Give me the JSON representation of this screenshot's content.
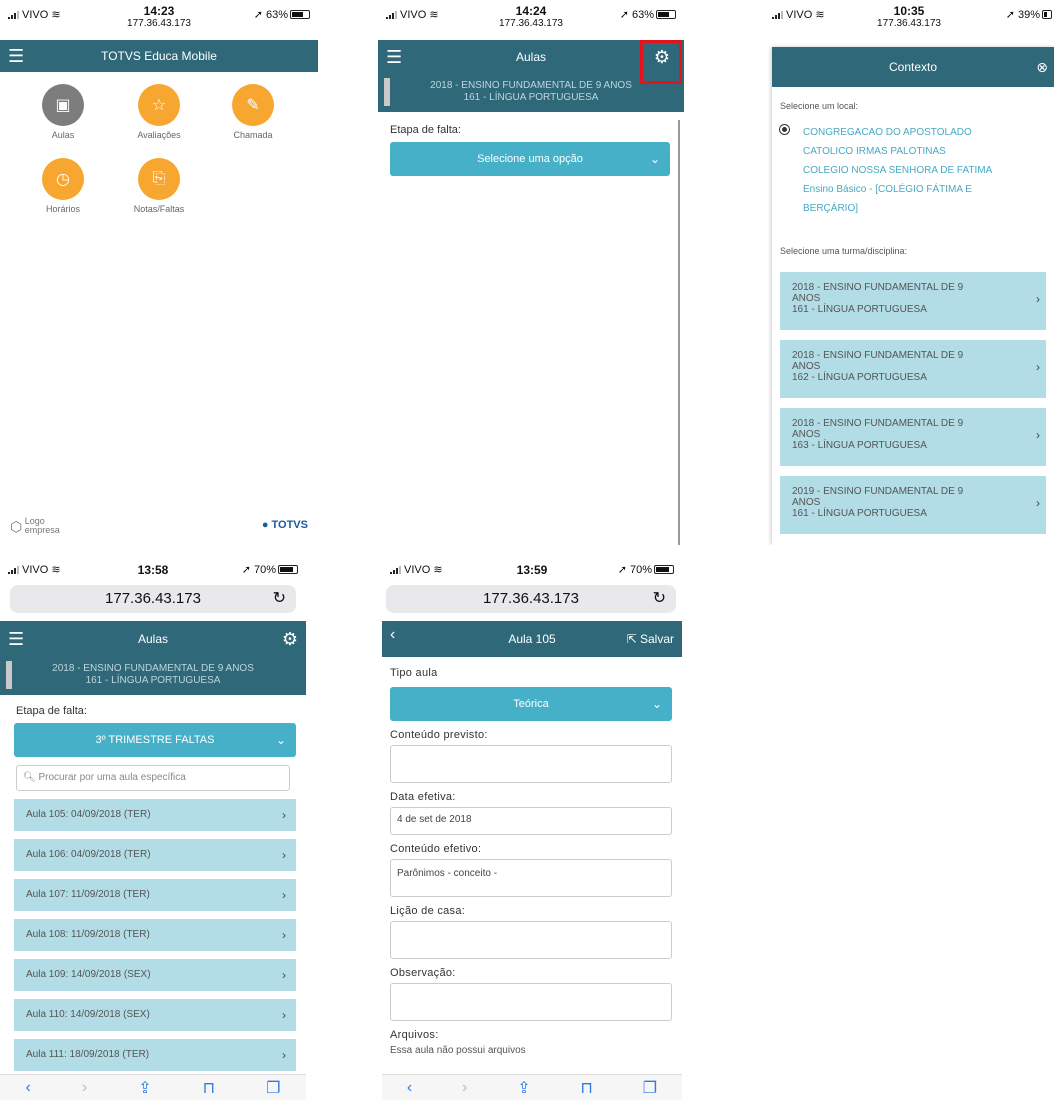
{
  "colors": {
    "primary": "#2f6879",
    "accent": "#47b0c9",
    "item_bg": "#b2dde6",
    "orange": "#f7a62f",
    "highlight": "#e5121b"
  },
  "screen1": {
    "status": {
      "carrier": "VIVO",
      "time": "14:23",
      "ip": "177.36.43.173",
      "battery": "63%"
    },
    "title": "TOTVS Educa Mobile",
    "tiles": [
      {
        "label": "Aulas",
        "icon": "presentation-icon"
      },
      {
        "label": "Avaliações",
        "icon": "clipboard-star-icon"
      },
      {
        "label": "Chamada",
        "icon": "edit-icon"
      },
      {
        "label": "Horários",
        "icon": "clock-icon"
      },
      {
        "label": "Notas/Faltas",
        "icon": "document-icon"
      }
    ],
    "footer_logo": "Logo\nempresa",
    "footer_brand": "TOTVS"
  },
  "screen2": {
    "status": {
      "carrier": "VIVO",
      "time": "14:24",
      "ip": "177.36.43.173",
      "battery": "63%"
    },
    "title": "Aulas",
    "banner_line1": "2018 - ENSINO FUNDAMENTAL DE 9 ANOS",
    "banner_line2": "161 - LÍNGUA PORTUGUESA",
    "etapa_label": "Etapa de falta:",
    "etapa_select": "Selecione uma opção"
  },
  "screen3": {
    "status": {
      "carrier": "VIVO",
      "time": "10:35",
      "ip": "177.36.43.173",
      "battery": "39%"
    },
    "modal_title": "Contexto",
    "local_label": "Selecione um local:",
    "local_option": "CONGREGACAO DO APOSTOLADO CATOLICO IRMAS PALOTINAS COLEGIO NOSSA SENHORA DE FATIMA Ensino Básico - [COLÉGIO FÁTIMA E BERÇÁRIO]",
    "local_lines": [
      "CONGREGACAO DO APOSTOLADO",
      "CATOLICO IRMAS PALOTINAS",
      "COLEGIO NOSSA SENHORA DE FATIMA",
      "Ensino Básico - [COLÉGIO FÁTIMA E",
      "BERÇÁRIO]"
    ],
    "turma_label": "Selecione uma turma/disciplina:",
    "turmas": [
      {
        "l1": "2018 - ENSINO FUNDAMENTAL DE 9",
        "l2": "ANOS",
        "l3": "161 - LÍNGUA PORTUGUESA"
      },
      {
        "l1": "2018 - ENSINO FUNDAMENTAL DE 9",
        "l2": "ANOS",
        "l3": "162 - LÍNGUA PORTUGUESA"
      },
      {
        "l1": "2018 - ENSINO FUNDAMENTAL DE 9",
        "l2": "ANOS",
        "l3": "163 - LÍNGUA PORTUGUESA"
      },
      {
        "l1": "2019 - ENSINO FUNDAMENTAL DE 9",
        "l2": "ANOS",
        "l3": "161 - LÍNGUA PORTUGUESA"
      }
    ]
  },
  "screen4": {
    "status": {
      "carrier": "VIVO",
      "time": "13:58",
      "battery": "70%"
    },
    "url": "177.36.43.173",
    "title": "Aulas",
    "banner_line1": "2018 - ENSINO FUNDAMENTAL DE 9 ANOS",
    "banner_line2": "161 - LÍNGUA PORTUGUESA",
    "etapa_label": "Etapa de falta:",
    "etapa_select": "3º TRIMESTRE FALTAS",
    "search_placeholder": "Procurar por uma aula específica",
    "lessons": [
      "Aula 105: 04/09/2018 (TER)",
      "Aula 106: 04/09/2018 (TER)",
      "Aula 107: 11/09/2018 (TER)",
      "Aula 108: 11/09/2018 (TER)",
      "Aula 109: 14/09/2018 (SEX)",
      "Aula 110: 14/09/2018 (SEX)",
      "Aula 111: 18/09/2018 (TER)"
    ]
  },
  "screen5": {
    "status": {
      "carrier": "VIVO",
      "time": "13:59",
      "battery": "70%"
    },
    "url": "177.36.43.173",
    "title": "Aula 105",
    "save_label": "Salvar",
    "tipo_label": "Tipo aula",
    "tipo_value": "Teórica",
    "conteudo_previsto_label": "Conteúdo previsto:",
    "conteudo_previsto_value": "",
    "data_label": "Data efetiva:",
    "data_value": "4 de set de 2018",
    "conteudo_efetivo_label": "Conteúdo efetivo:",
    "conteudo_efetivo_value": "Parônimos - conceito -",
    "licao_label": "Lição de casa:",
    "licao_value": "",
    "obs_label": "Observação:",
    "obs_value": "",
    "arquivos_label": "Arquivos:",
    "arquivos_value": "Essa aula não possui arquivos"
  }
}
